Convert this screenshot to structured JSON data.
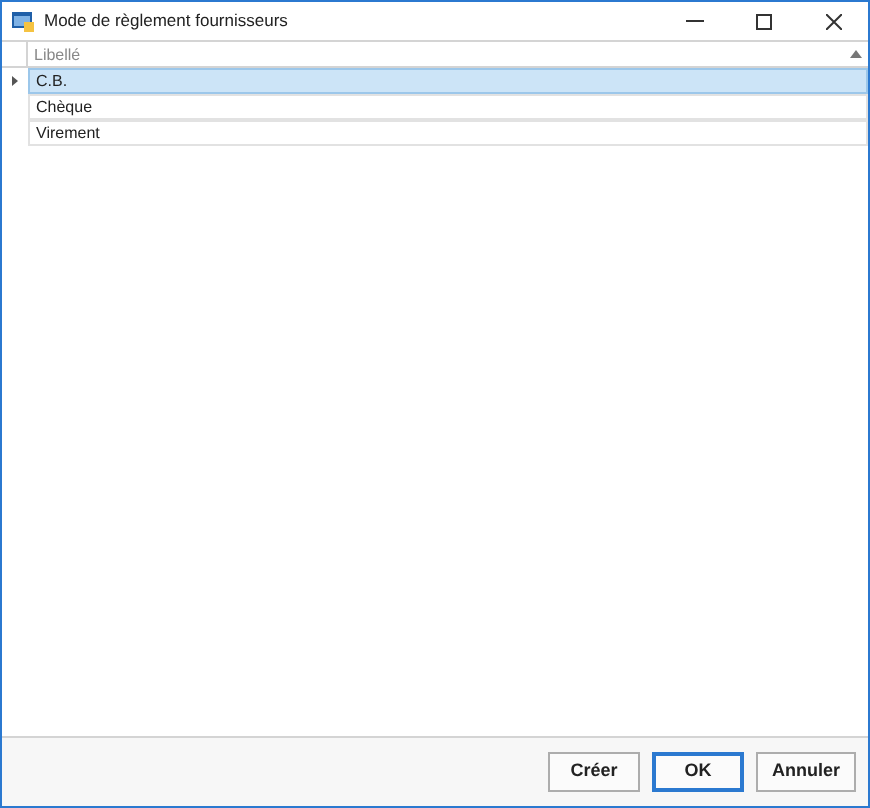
{
  "window": {
    "title": "Mode de règlement fournisseurs"
  },
  "table": {
    "columns": [
      "Libellé"
    ],
    "rows": [
      {
        "cells": [
          "C.B."
        ],
        "selected": true
      },
      {
        "cells": [
          "Chèque"
        ],
        "selected": false
      },
      {
        "cells": [
          "Virement"
        ],
        "selected": false
      }
    ]
  },
  "buttons": [
    {
      "label": "Créer",
      "default": false
    },
    {
      "label": "OK",
      "default": true
    },
    {
      "label": "Annuler",
      "default": false
    }
  ]
}
